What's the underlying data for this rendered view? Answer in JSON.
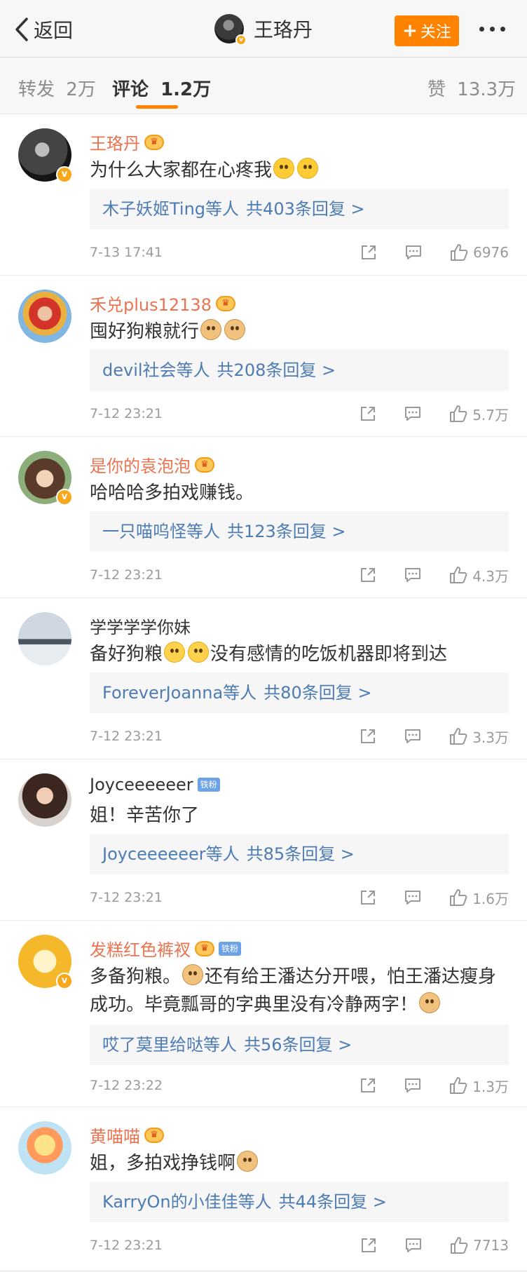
{
  "header": {
    "back_label": "返回",
    "author_name": "王珞丹",
    "follow_label": "关注"
  },
  "tabs": [
    {
      "label": "转发",
      "count": "2万"
    },
    {
      "label": "评论",
      "count": "1.2万"
    },
    {
      "label": "赞",
      "count": "13.3万"
    }
  ],
  "icons": {
    "back": "chevron-left-icon",
    "more": "more-dots-icon",
    "share": "share-icon",
    "reply": "comment-icon",
    "like": "thumbs-up-icon",
    "crown": "crown-badge-icon",
    "verified": "verified-v-icon"
  },
  "colors": {
    "accent": "#ff8200",
    "vip_name": "#eb7350",
    "link": "#4d7bb3",
    "verified": "#f7a81b"
  },
  "comments": [
    {
      "username": "王珞丹",
      "text": "为什么大家都在心疼我",
      "emoji": [
        "surprised",
        "confused"
      ],
      "reply_users": "木子妖姬Ting等人",
      "reply_count": "共403条回复 >",
      "time": "7-13 17:41",
      "likes": "6976"
    },
    {
      "username": "禾兑plus12138",
      "text": "囤好狗粮就行",
      "emoji": [
        "doge",
        "doge"
      ],
      "reply_users": "devil社会等人",
      "reply_count": "共208条回复 >",
      "time": "7-12 23:21",
      "likes": "5.7万"
    },
    {
      "username": "是你的袁泡泡",
      "text": "哈哈哈多拍戏赚钱。",
      "reply_users": "一只喵呜怪等人",
      "reply_count": "共123条回复 >",
      "time": "7-12 23:21",
      "likes": "4.3万"
    },
    {
      "username": "学学学学你妹",
      "text_before": "备好狗粮",
      "text_after": "没有感情的吃饭机器即将到达",
      "reply_users": "ForeverJoanna等人",
      "reply_count": "共80条回复 >",
      "time": "7-12 23:21",
      "likes": "3.3万"
    },
    {
      "username": "Joyceeeeeer",
      "badge": "铁粉",
      "text": "姐！辛苦你了",
      "reply_users": "Joyceeeeeer等人",
      "reply_count": "共85条回复 >",
      "time": "7-12 23:21",
      "likes": "1.6万"
    },
    {
      "username": "发糕红色裤衩",
      "badge": "铁粉",
      "text_a": "多备狗粮。",
      "text_b": "还有给王潘达分开喂，怕王潘达瘦身成功。毕竟瓢哥的字典里没有冷静两字！",
      "reply_users": "哎了莫里给哒等人",
      "reply_count": "共56条回复 >",
      "time": "7-12 23:22",
      "likes": "1.3万"
    },
    {
      "username": "黄喵喵",
      "text": "姐，多拍戏挣钱啊",
      "reply_users": "KarryOn的小佳佳等人",
      "reply_count": "共44条回复 >",
      "time": "7-12 23:21",
      "likes": "7713"
    }
  ]
}
